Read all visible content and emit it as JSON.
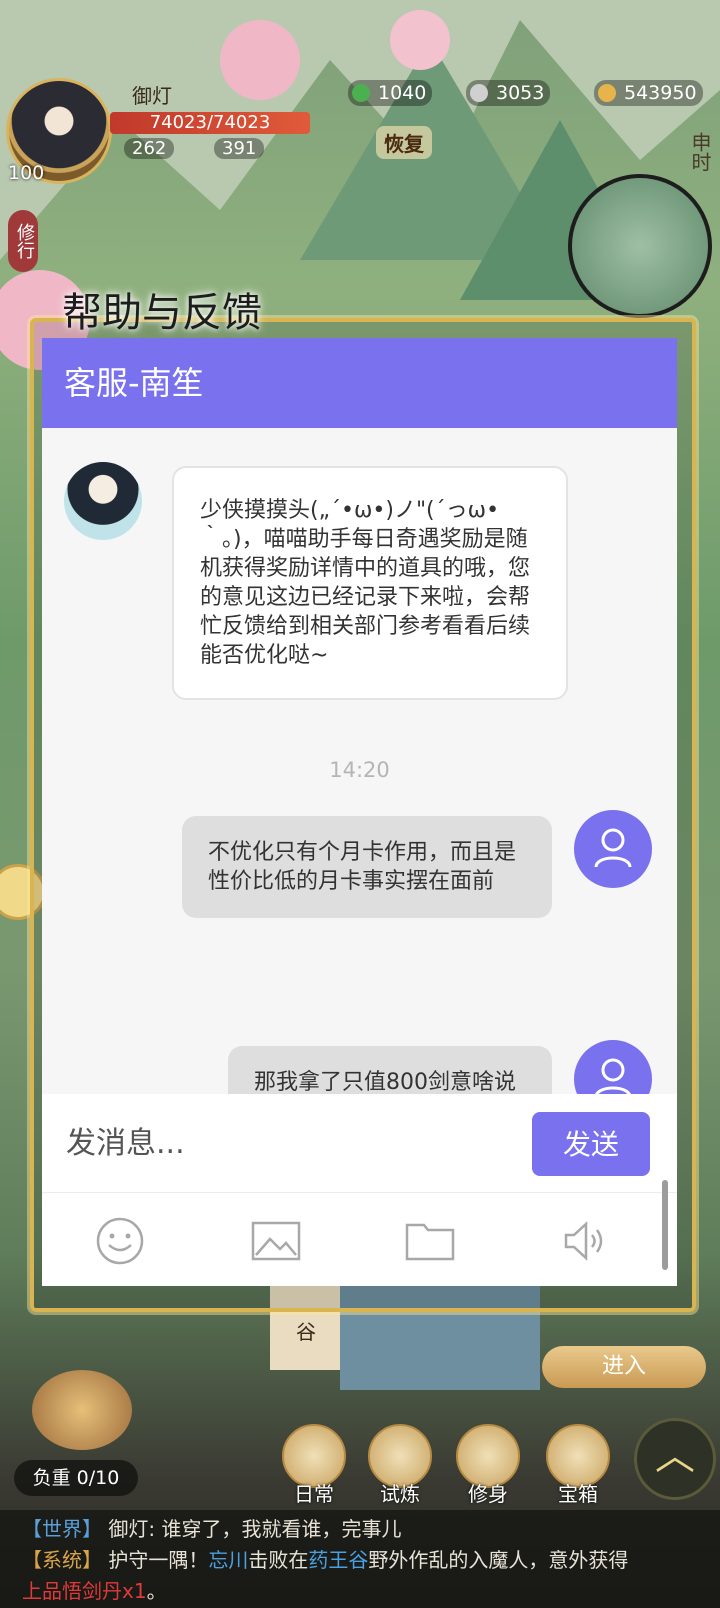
{
  "hud": {
    "player_name": "御灯",
    "level": "100",
    "hp": "74023/74023",
    "stat_left": "262",
    "stat_right": "391",
    "jade": "1040",
    "silver": "3053",
    "gold": "543950",
    "restore_label": "恢复",
    "cultivate_label": "修行",
    "time_label": "申时",
    "enter_label": "进入",
    "location_char": "谷",
    "load_label": "负重 0/10",
    "nav": [
      "日常",
      "试炼",
      "修身",
      "宝箱"
    ]
  },
  "help": {
    "title": "帮助与反馈",
    "header": "客服-南笙",
    "agent_message": "少侠摸摸头(„´•ω•)ノ\"(´っω•｀。)，喵喵助手每日奇遇奖励是随机获得奖励详情中的道具的哦，您的意见这边已经记录下来啦，会帮忙反馈给到相关部门参考看看后续能否优化哒~",
    "timestamp": "14:20",
    "user_message_1": "不优化只有个月卡作用，而且是性价比低的月卡事实摆在面前",
    "user_message_2": "那我拿了只值800剑意啥说",
    "input_placeholder": "发消息...",
    "send_label": "发送",
    "tools": [
      "emoji-icon",
      "image-icon",
      "folder-icon",
      "voice-icon"
    ],
    "accent_color": "#7a71ee"
  },
  "chat_log": {
    "line1_tag": "【世界】",
    "line1_text": "御灯: 谁穿了，我就看谁，完事儿",
    "line2_tag": "【系统】",
    "line2_a": "护守一隅！",
    "line2_name": "忘川",
    "line2_b": "击败在",
    "line2_place": "药王谷",
    "line2_c": "野外作乱的入魔人，意外获得",
    "line3_item": "上品悟剑丹x1",
    "line3_end": "。"
  }
}
